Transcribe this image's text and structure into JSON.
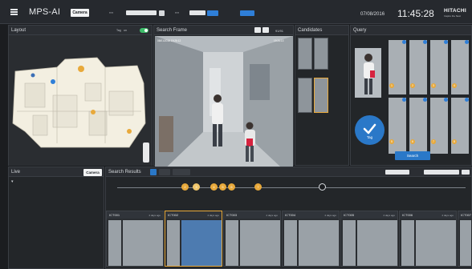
{
  "app": {
    "title": "MPS-AI",
    "mode_button": "Camera",
    "date": "07/08/2016",
    "time": "11:45:28",
    "brand": "HITACHI",
    "brand_tagline": "Inspire the Next",
    "toggle_label": "Tag",
    "toggle_state": "on"
  },
  "layout_panel": {
    "title": "Layout"
  },
  "search_frame": {
    "title": "Search Frame",
    "counter": "91/91",
    "timestamp": "08/01/2016 19:26:12",
    "timestamp_right": "19:26:13"
  },
  "candidates": {
    "title": "Candidates"
  },
  "query": {
    "title": "Query",
    "tag_button": "Tag",
    "search_button": "Search",
    "markers": [
      "1",
      "2",
      "3",
      "4",
      "5",
      "6",
      "7",
      "8"
    ]
  },
  "live": {
    "title": "Live",
    "camera_button": "Camera"
  },
  "search_results": {
    "title": "Search Results",
    "timeline_markers": [
      "2",
      "3",
      "4",
      "5",
      "6",
      "7"
    ],
    "results": [
      {
        "id": "ICT001",
        "age": "4 days ago"
      },
      {
        "id": "ICT002",
        "age": "4 days ago"
      },
      {
        "id": "ICT003",
        "age": "4 days ago"
      },
      {
        "id": "ICT004",
        "age": "4 days ago"
      },
      {
        "id": "ICT005",
        "age": "4 days ago"
      },
      {
        "id": "ICT006",
        "age": "4 days ago"
      },
      {
        "id": "ICT007",
        "age": "4 days ago"
      },
      {
        "id": "ICT008",
        "age": "4 days ago"
      }
    ]
  },
  "colors": {
    "accent_blue": "#2a78c8",
    "accent_orange": "#e8a93b",
    "toggle_green": "#3ebd6a",
    "panel_bg": "#232629"
  }
}
